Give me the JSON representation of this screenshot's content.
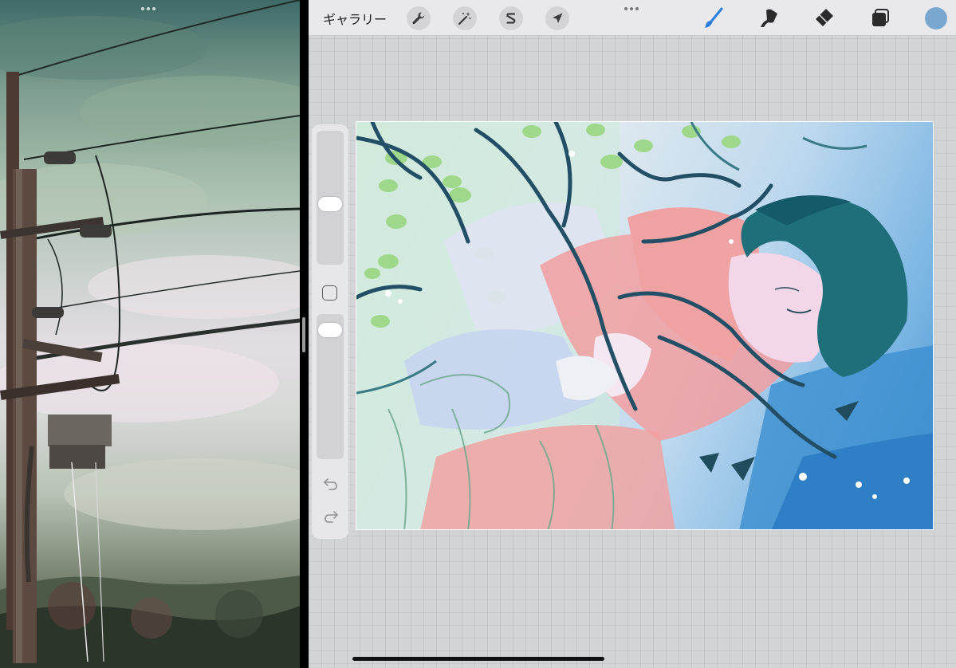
{
  "toolbar": {
    "gallery_label": "ギャラリー",
    "actions_icon": "wrench-icon",
    "adjustments_icon": "magic-wand-icon",
    "selection_icon": "selection-s-icon",
    "transform_icon": "arrow-cursor-icon",
    "brush_icon": "brush-icon",
    "smudge_icon": "smudge-icon",
    "eraser_icon": "eraser-icon",
    "layers_icon": "layers-icon",
    "current_color": "#7aa7cf"
  },
  "sidebar": {
    "brush_size_level": 0.45,
    "opacity_level": 0.93,
    "undo_icon": "undo-icon",
    "redo_icon": "redo-icon",
    "modify_icon": "square-icon"
  },
  "colors": {
    "accent": "#2a7de1",
    "toolbar_bg": "#e9e9eb",
    "workspace_bg": "#d3d4d6"
  }
}
